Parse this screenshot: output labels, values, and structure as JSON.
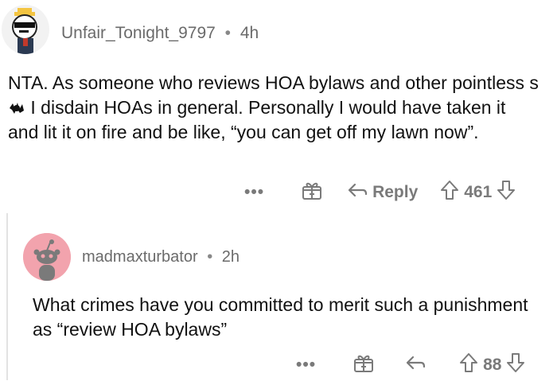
{
  "comment1": {
    "username": "Unfair_Tonight_9797",
    "time": "4h",
    "body_before": "NTA. As someone who reviews HOA bylaws and other pointless s",
    "body_after": " I disdain HOAs in general. Personally I would have taken it and lit it on fire and be like, “you can get off my lawn now”.",
    "more": "•••",
    "reply_label": "Reply",
    "score": "461"
  },
  "comment2": {
    "username": "madmaxturbator",
    "time": "2h",
    "body": "What crimes have you committed to merit such a punishment as “review HOA bylaws”",
    "more": "•••",
    "score": "88"
  },
  "separator": "•",
  "icons": {
    "avatar1": "pixel-art-avatar-icon",
    "censor": "censor-scribble-icon",
    "award": "award-gift-icon",
    "reply": "reply-arrow-icon",
    "upvote": "upvote-arrow-icon",
    "downvote": "downvote-arrow-icon",
    "avatar2": "snoo-avatar-icon"
  },
  "colors": {
    "meta_text": "#6b6b6b",
    "icon_gray": "#7a7a7a",
    "avatar2_bg": "#f2a3ad"
  }
}
